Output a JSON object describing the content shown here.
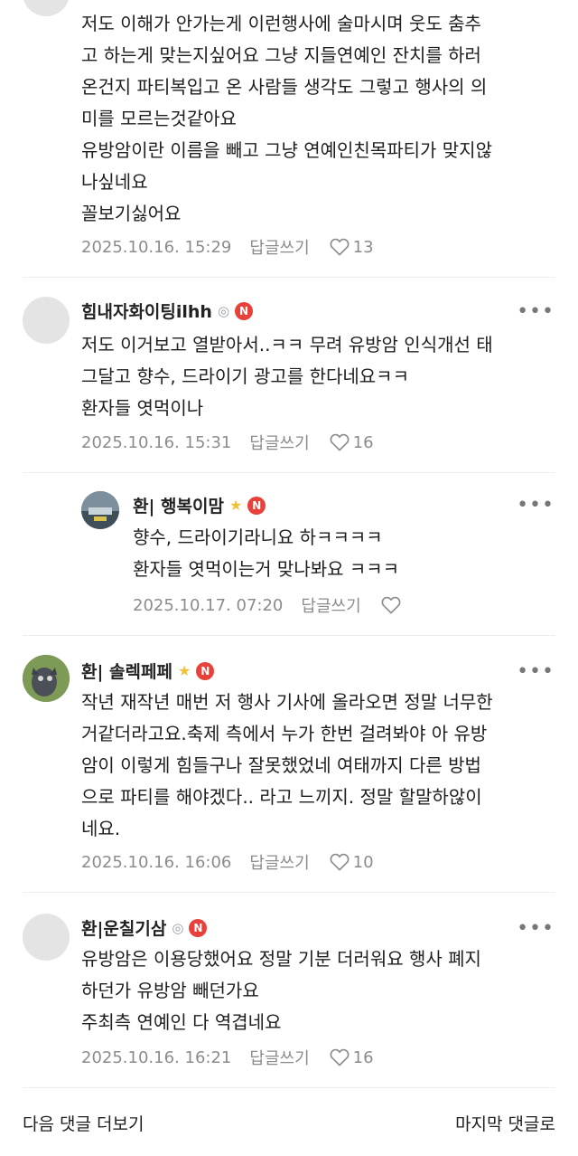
{
  "comments": [
    {
      "lines": [
        "저도 이해가 안가는게 이런행사에 술마시며 웃도 춤추",
        "고 하는게 맞는지싶어요 그냥 지들연예인 잔치를 하러",
        "온건지 파티복입고 온 사람들 생각도 그렇고 행사의 의",
        "미를 모르는것같아요",
        "유방암이란 이름을 빼고 그냥 연예인친목파티가 맞지않",
        "나싶네요",
        "꼴보기싫어요"
      ],
      "date": "2025.10.16. 15:29",
      "reply": "답글쓰기",
      "likes": "13"
    },
    {
      "nick": "힘내자화이팅ilhh",
      "lines": [
        "저도 이거보고 열받아서..ㅋㅋ 무려 유방암 인식개선 태",
        "그달고 향수, 드라이기 광고를 한다네요ㅋㅋ",
        "환자들 엿먹이나"
      ],
      "date": "2025.10.16. 15:31",
      "reply": "답글쓰기",
      "likes": "16"
    },
    {
      "nick": "환| 행복이맘",
      "lines": [
        "향수, 드라이기라니요 하ㅋㅋㅋㅋ",
        "환자들 엿먹이는거 맞나봐요 ㅋㅋㅋ"
      ],
      "date": "2025.10.17. 07:20",
      "reply": "답글쓰기",
      "likes": ""
    },
    {
      "nick": "환| 솔렉페페",
      "lines": [
        "작년 재작년 매번 저 행사 기사에 올라오면 정말 너무한",
        "거같더라고요.축제 측에서 누가 한번 걸려봐야 아 유방",
        "암이 이렇게 힘들구나 잘못했었네 여태까지 다른 방법",
        "으로 파티를 해야겠다.. 라고 느끼지. 정말 할말하않이",
        "네요."
      ],
      "date": "2025.10.16. 16:06",
      "reply": "답글쓰기",
      "likes": "10"
    },
    {
      "nick": "환|운칠기삼",
      "lines": [
        "유방암은 이용당했어요 정말 기분 더러워요 행사 폐지",
        "하던가 유방암 빼던가요",
        "주최측 연예인 다 역겹네요"
      ],
      "date": "2025.10.16. 16:21",
      "reply": "답글쓰기",
      "likes": "16"
    }
  ],
  "badge_n": "N",
  "more_glyph": "•••",
  "footer": {
    "next": "다음 댓글 더보기",
    "last": "마지막 댓글로"
  },
  "colors": {
    "badge": "#e8413a",
    "meta": "#8c8c8c",
    "text": "#1e1e1e"
  },
  "icons": [
    "heart-icon",
    "more-icon",
    "medal-icon",
    "star-icon"
  ]
}
